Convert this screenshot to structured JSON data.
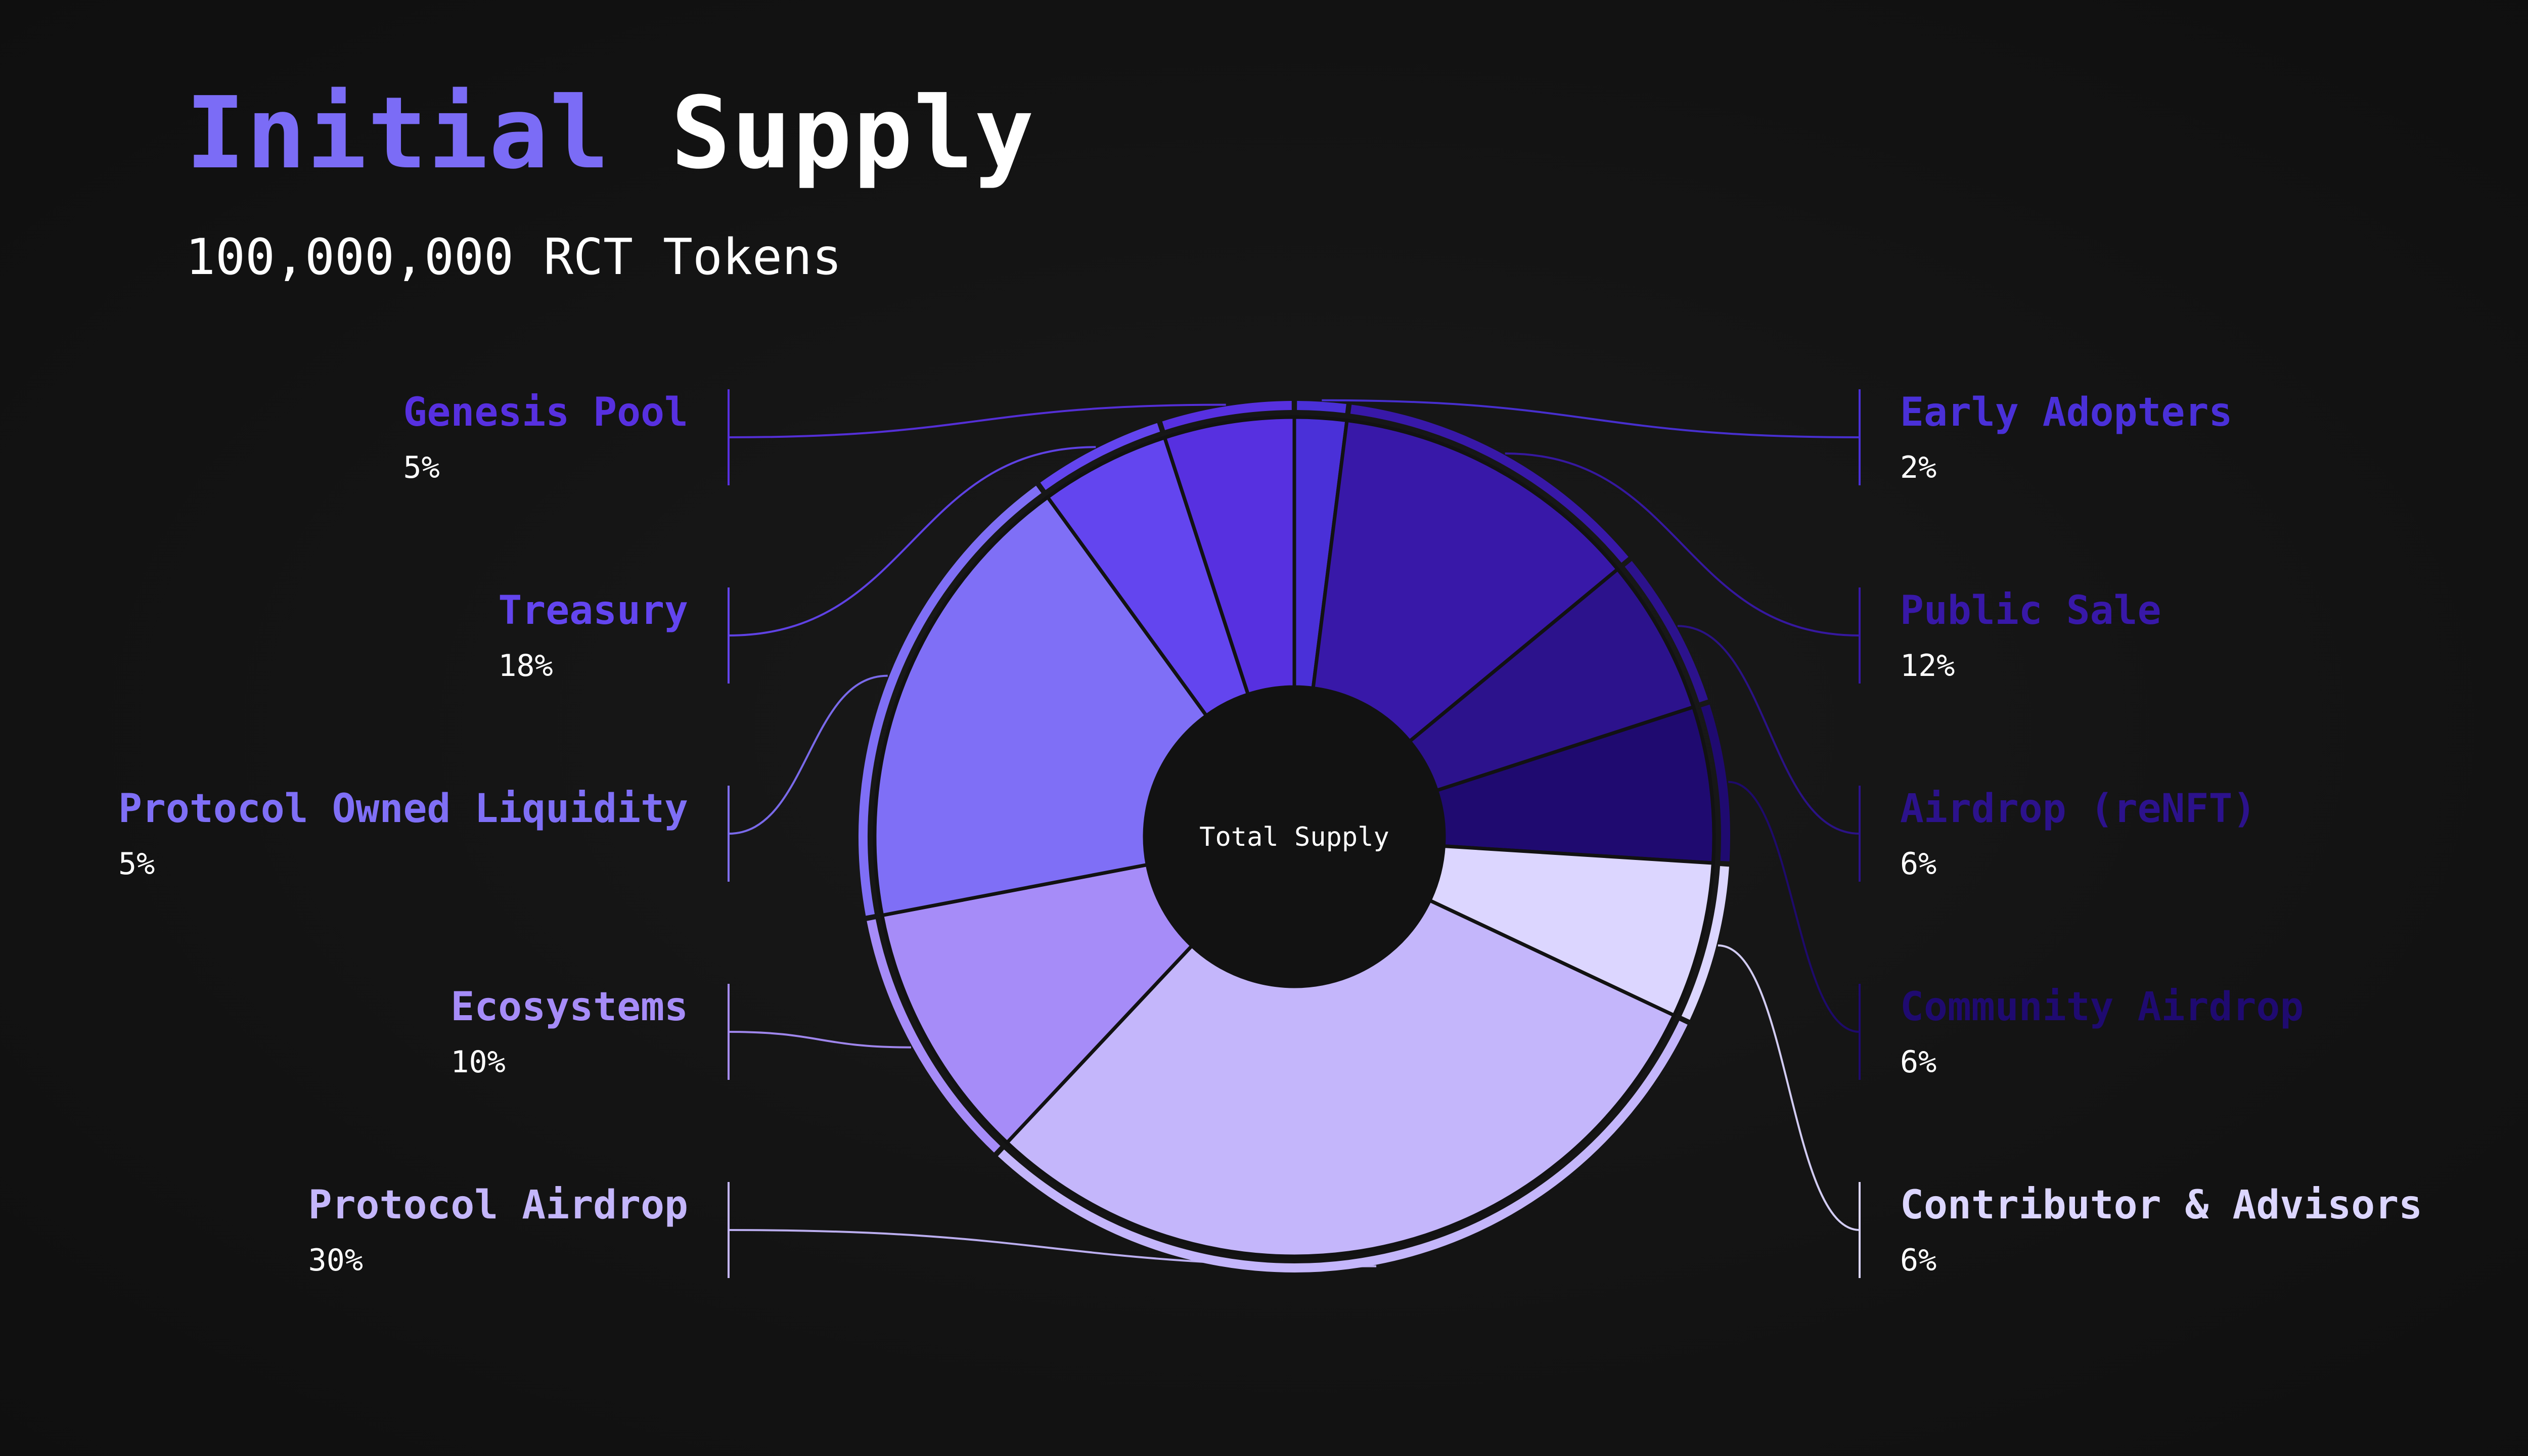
{
  "title": {
    "highlight": "Initial",
    "rest": "Supply",
    "highlight_color": "#7b6cf6",
    "rest_color": "#ffffff"
  },
  "subtitle": "100,000,000 RCT Tokens",
  "center_label": "Total Supply",
  "colors": {
    "background": "#121212",
    "divider": "#121212"
  },
  "chart_data": {
    "type": "pie",
    "title": "Initial Supply",
    "subtitle": "100,000,000 RCT Tokens",
    "center_label": "Total Supply",
    "unit": "%",
    "slices": [
      {
        "label": "Early Adopters",
        "display": "2%",
        "value": 2,
        "color": "#4a30d8",
        "side": "right"
      },
      {
        "label": "Public Sale",
        "display": "12%",
        "value": 12,
        "color": "#3818a8",
        "side": "right"
      },
      {
        "label": "Airdrop (reNFT)",
        "display": "6%",
        "value": 6,
        "color": "#2c128c",
        "side": "right"
      },
      {
        "label": "Community Airdrop",
        "display": "6%",
        "value": 6,
        "color": "#1f0a70",
        "side": "right"
      },
      {
        "label": "Contributor & Advisors",
        "display": "6%",
        "value": 6,
        "color": "#dcd6ff",
        "side": "right"
      },
      {
        "label": "Protocol Airdrop",
        "display": "30%",
        "value": 30,
        "color": "#c4b6fb",
        "side": "left"
      },
      {
        "label": "Ecosystems",
        "display": "10%",
        "value": 10,
        "color": "#a68cf8",
        "side": "left"
      },
      {
        "label": "Protocol Owned Liquidity",
        "display": "5%",
        "value": 18,
        "color": "#7f6ff6",
        "side": "left"
      },
      {
        "label": "Treasury",
        "display": "18%",
        "value": 5,
        "color": "#6345ef",
        "side": "left"
      },
      {
        "label": "Genesis Pool",
        "display": "5%",
        "value": 5,
        "color": "#5730e0",
        "side": "left"
      }
    ]
  }
}
